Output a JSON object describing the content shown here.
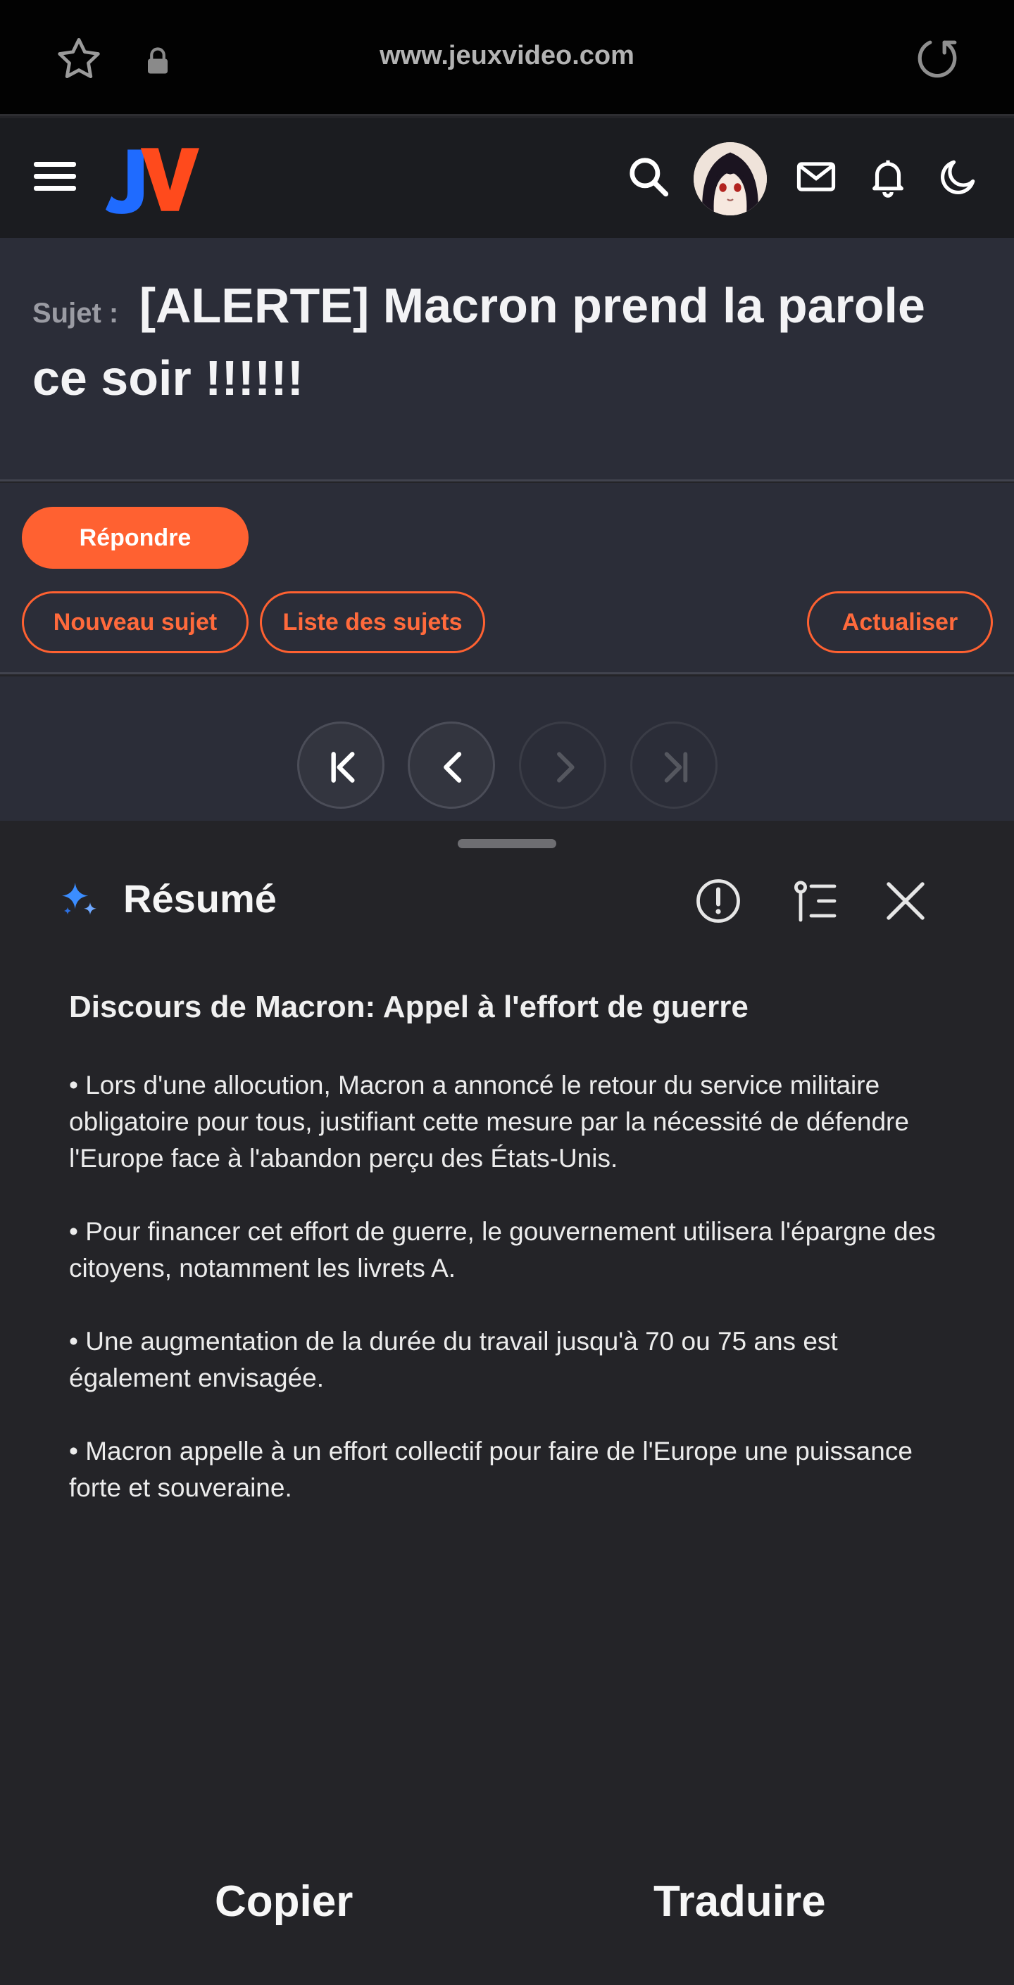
{
  "browser": {
    "url": "www.jeuxvideo.com",
    "icons": [
      "star-icon",
      "lock-icon",
      "reload-icon"
    ]
  },
  "header": {
    "logo": "JV",
    "icons": [
      "menu-icon",
      "search-icon",
      "avatar",
      "mail-icon",
      "bell-icon",
      "moon-icon"
    ]
  },
  "topic": {
    "prefix": "Sujet :",
    "title": "[ALERTE] Macron prend la parole ce soir !!!!!!"
  },
  "actions": {
    "reply": "Répondre",
    "new_topic": "Nouveau sujet",
    "topic_list": "Liste des sujets",
    "refresh": "Actualiser"
  },
  "pager": {
    "buttons": [
      {
        "name": "first-page",
        "enabled": true
      },
      {
        "name": "previous-page",
        "enabled": true
      },
      {
        "name": "next-page",
        "enabled": false
      },
      {
        "name": "last-page",
        "enabled": false
      }
    ]
  },
  "summary": {
    "title": "Résumé",
    "heading": "Discours de Macron: Appel à l'effort de guerre",
    "bullets": [
      "• Lors d'une allocution, Macron a annoncé le retour du service militaire obligatoire pour tous,  justifiant cette mesure par la nécessité de défendre l'Europe face à l'abandon perçu des États-Unis.",
      "• Pour financer cet effort de guerre, le gouvernement utilisera l'épargne des citoyens, notamment les livrets A.",
      "• Une augmentation de la durée du travail jusqu'à 70 ou 75 ans est également envisagée.",
      "• Macron appelle à un effort collectif pour faire de l'Europe une puissance forte et souveraine."
    ],
    "copy": "Copier",
    "translate": "Traduire"
  },
  "colors": {
    "accent": "#ff6131",
    "background": "#242428",
    "topic_bg": "#2b2d38"
  }
}
